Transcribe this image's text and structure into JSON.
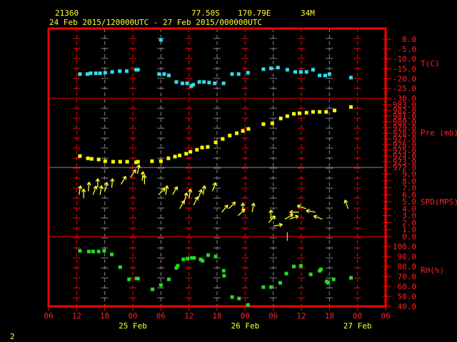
{
  "header": {
    "station": "21360",
    "lat": "77.50S",
    "lon": "170.79E",
    "elev": "34M",
    "time_range": "24 Feb 2015/120000UTC - 27 Feb 2015/000000UTC"
  },
  "footer": {
    "frame_number": "2"
  },
  "colors": {
    "frame": "#ff0000",
    "temp": "#33ddee",
    "pres": "#ffff00",
    "wind": "#ffff33",
    "rh": "#22dd22",
    "grid_gray": "#888888"
  },
  "chart_data": {
    "type": "scatter",
    "x_units": "hours since 24 Feb 2015 06UTC",
    "xlim": [
      0,
      72
    ],
    "x_ticks": [
      "06",
      "12",
      "18",
      "00",
      "06",
      "12",
      "18",
      "00",
      "06",
      "12",
      "18",
      "00",
      "06"
    ],
    "date_labels": [
      {
        "label": "25 Feb",
        "hour": 18
      },
      {
        "label": "26 Feb",
        "hour": 42
      },
      {
        "label": "27 Feb",
        "hour": 66
      }
    ],
    "panels": [
      {
        "name": "T(C)",
        "ylim": [
          -30,
          0
        ],
        "ticks": [
          "0.0",
          "-5.0",
          "-10.0",
          "-15.0",
          "-20.0",
          "-25.0",
          "-30.0"
        ],
        "tick_values": [
          0,
          -5,
          -10,
          -15,
          -20,
          -25,
          -30
        ],
        "color": "#33ddee",
        "points": [
          [
            6.7,
            -17.7
          ],
          [
            8.3,
            -17.7
          ],
          [
            9.0,
            -17.3
          ],
          [
            10.1,
            -17.3
          ],
          [
            11.0,
            -17.3
          ],
          [
            12.1,
            -17.0
          ],
          [
            13.6,
            -16.6
          ],
          [
            15.2,
            -16.2
          ],
          [
            16.7,
            -16.2
          ],
          [
            18.7,
            -15.5
          ],
          [
            19.1,
            -15.5
          ],
          [
            23.6,
            -17.7
          ],
          [
            24.0,
            -0.4
          ],
          [
            24.7,
            -17.7
          ],
          [
            25.7,
            -18.4
          ],
          [
            27.3,
            -21.7
          ],
          [
            28.6,
            -22.4
          ],
          [
            29.6,
            -22.4
          ],
          [
            30.5,
            -23.8
          ],
          [
            30.9,
            -23.1
          ],
          [
            32.2,
            -21.7
          ],
          [
            33.2,
            -21.7
          ],
          [
            34.3,
            -22.0
          ],
          [
            35.5,
            -22.4
          ],
          [
            37.4,
            -22.4
          ],
          [
            39.2,
            -17.7
          ],
          [
            40.6,
            -17.7
          ],
          [
            42.6,
            -17.0
          ],
          [
            45.9,
            -15.2
          ],
          [
            47.5,
            -14.8
          ],
          [
            49.0,
            -14.4
          ],
          [
            51.0,
            -15.5
          ],
          [
            52.7,
            -16.6
          ],
          [
            53.9,
            -16.6
          ],
          [
            55.1,
            -16.6
          ],
          [
            56.5,
            -15.5
          ],
          [
            57.9,
            -18.4
          ],
          [
            59.1,
            -18.4
          ],
          [
            60.0,
            -17.7
          ],
          [
            64.6,
            -19.5
          ]
        ]
      },
      {
        "name": "Pre (mb)",
        "ylim": [
          972,
          983.5
        ],
        "ticks": [
          "983.0",
          "982.0",
          "981.0",
          "980.0",
          "979.0",
          "978.0",
          "977.0",
          "976.0",
          "975.0",
          "974.0",
          "973.0",
          "972.0"
        ],
        "tick_values": [
          983,
          982,
          981,
          980,
          979,
          978,
          977,
          976,
          975,
          974,
          973,
          972
        ],
        "color": "#ffff00",
        "points": [
          [
            6.7,
            974.0
          ],
          [
            8.4,
            973.6
          ],
          [
            9.2,
            973.5
          ],
          [
            10.7,
            973.4
          ],
          [
            12.1,
            973.1
          ],
          [
            13.8,
            973.0
          ],
          [
            15.3,
            973.0
          ],
          [
            16.8,
            973.0
          ],
          [
            18.7,
            972.9
          ],
          [
            19.1,
            973.0
          ],
          [
            22.1,
            973.1
          ],
          [
            24.0,
            973.1
          ],
          [
            25.6,
            973.6
          ],
          [
            27.0,
            973.9
          ],
          [
            28.0,
            974.1
          ],
          [
            29.4,
            974.4
          ],
          [
            30.3,
            974.75
          ],
          [
            31.7,
            975.1
          ],
          [
            32.8,
            975.5
          ],
          [
            34.0,
            975.6
          ],
          [
            35.7,
            976.4
          ],
          [
            37.2,
            977.0
          ],
          [
            38.7,
            977.6
          ],
          [
            40.2,
            978.0
          ],
          [
            41.5,
            978.4
          ],
          [
            42.7,
            978.75
          ],
          [
            45.9,
            979.6
          ],
          [
            47.8,
            979.75
          ],
          [
            49.6,
            980.6
          ],
          [
            51.0,
            981.0
          ],
          [
            52.4,
            981.4
          ],
          [
            53.6,
            981.5
          ],
          [
            55.1,
            981.6
          ],
          [
            56.5,
            981.75
          ],
          [
            57.9,
            981.75
          ],
          [
            59.3,
            981.75
          ],
          [
            61.1,
            982.0
          ],
          [
            64.6,
            982.6
          ]
        ]
      },
      {
        "name": "SPD(MPS)",
        "ylim": [
          0,
          9
        ],
        "ticks": [
          "9.0",
          "8.0",
          "7.0",
          "6.0",
          "5.0",
          "4.0",
          "3.0",
          "2.0",
          "1.0",
          "0.0"
        ],
        "tick_values": [
          9,
          8,
          7,
          6,
          5,
          4,
          3,
          2,
          1,
          0
        ],
        "color": "#ffff33",
        "arrows_hour_speed_heading": [
          [
            6.5,
            6.0,
            10
          ],
          [
            7.5,
            5.5,
            0
          ],
          [
            8.5,
            6.5,
            5
          ],
          [
            9.5,
            6.0,
            20
          ],
          [
            10.5,
            7.0,
            0
          ],
          [
            11.0,
            6.0,
            10
          ],
          [
            12.0,
            6.5,
            15
          ],
          [
            13.5,
            7.0,
            5
          ],
          [
            15.5,
            7.5,
            30
          ],
          [
            17.5,
            8.5,
            35
          ],
          [
            19.0,
            9.0,
            10
          ],
          [
            20.0,
            8.0,
            5
          ],
          [
            20.5,
            7.5,
            0
          ],
          [
            23.5,
            6.0,
            45
          ],
          [
            25.0,
            6.0,
            10
          ],
          [
            26.5,
            6.0,
            30
          ],
          [
            28.0,
            4.0,
            30
          ],
          [
            29.0,
            5.0,
            15
          ],
          [
            30.0,
            5.5,
            10
          ],
          [
            31.0,
            4.5,
            25
          ],
          [
            32.0,
            5.5,
            20
          ],
          [
            33.0,
            6.0,
            10
          ],
          [
            35.0,
            6.5,
            20
          ],
          [
            37.0,
            3.5,
            40
          ],
          [
            38.5,
            4.0,
            45
          ],
          [
            40.5,
            3.0,
            45
          ],
          [
            41.5,
            3.5,
            0
          ],
          [
            43.5,
            3.5,
            10
          ],
          [
            47.0,
            2.0,
            45
          ],
          [
            47.5,
            2.5,
            0
          ],
          [
            48.0,
            1.5,
            80
          ],
          [
            50.5,
            2.5,
            60
          ],
          [
            51.5,
            2.5,
            70
          ],
          [
            53.5,
            3.5,
            270
          ],
          [
            55.0,
            4.0,
            290
          ],
          [
            57.0,
            3.5,
            280
          ],
          [
            58.5,
            2.5,
            290
          ],
          [
            64.0,
            4.0,
            340
          ]
        ],
        "calm_marks": [
          51.0
        ]
      },
      {
        "name": "RH(%)",
        "ylim": [
          40,
          100
        ],
        "ticks": [
          "100.0",
          "90.0",
          "80.0",
          "70.0",
          "60.0",
          "50.0",
          "40.0"
        ],
        "tick_values": [
          100,
          90,
          80,
          70,
          60,
          50,
          40
        ],
        "color": "#22dd22",
        "points": [
          [
            6.7,
            95.7
          ],
          [
            8.6,
            95.0
          ],
          [
            9.5,
            95.0
          ],
          [
            10.7,
            95.0
          ],
          [
            11.9,
            95.7
          ],
          [
            13.5,
            92.1
          ],
          [
            15.3,
            79.3
          ],
          [
            17.2,
            67.1
          ],
          [
            18.8,
            67.9
          ],
          [
            19.1,
            67.9
          ],
          [
            22.2,
            57.1
          ],
          [
            24.0,
            61.4
          ],
          [
            25.7,
            67.1
          ],
          [
            27.3,
            78.6
          ],
          [
            27.6,
            80.7
          ],
          [
            28.8,
            87.1
          ],
          [
            29.7,
            87.9
          ],
          [
            30.6,
            88.6
          ],
          [
            31.1,
            88.6
          ],
          [
            32.5,
            87.1
          ],
          [
            32.9,
            85.7
          ],
          [
            34.1,
            91.4
          ],
          [
            35.7,
            90.0
          ],
          [
            37.4,
            75.7
          ],
          [
            37.5,
            70.7
          ],
          [
            39.2,
            49.3
          ],
          [
            40.7,
            47.9
          ],
          [
            42.6,
            41.4
          ],
          [
            45.9,
            59.3
          ],
          [
            47.5,
            59.3
          ],
          [
            49.5,
            63.6
          ],
          [
            50.8,
            72.9
          ],
          [
            52.4,
            80.0
          ],
          [
            53.9,
            80.7
          ],
          [
            56.0,
            72.1
          ],
          [
            57.9,
            75.7
          ],
          [
            58.2,
            77.1
          ],
          [
            59.4,
            65.0
          ],
          [
            59.7,
            63.6
          ],
          [
            60.9,
            67.1
          ],
          [
            64.6,
            68.6
          ]
        ]
      }
    ]
  }
}
